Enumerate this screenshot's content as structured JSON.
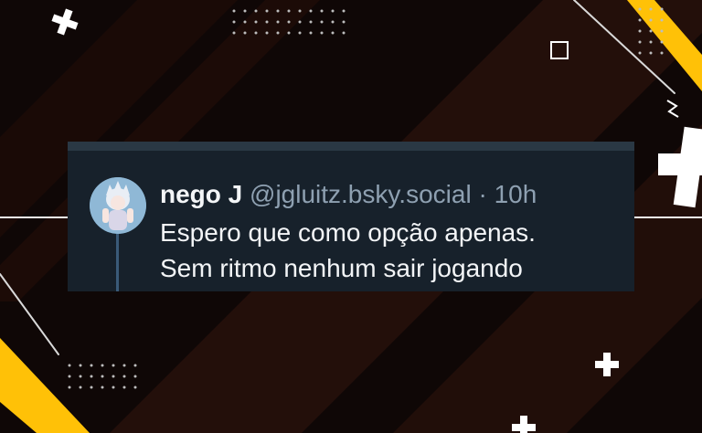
{
  "post": {
    "author_name": "nego J",
    "handle": "@jgluitz.bsky.social",
    "separator": "·",
    "time": "10h",
    "text_lines": [
      "Espero que como opção apenas.",
      "Sem ritmo nenhum sair jogando"
    ]
  },
  "colors": {
    "background": "#0f0706",
    "stripe": "#2a120c",
    "accent_yellow": "#ffc107",
    "card": "#17212b",
    "text_primary": "#f3f5f7",
    "text_secondary": "#8ea0b1",
    "thread_line": "#3a5a78"
  },
  "icons": {
    "avatar": "anime-character-avatar",
    "decorations": [
      "plus-icon",
      "square-outline-icon",
      "dot-grid",
      "diagonal-stripe"
    ]
  }
}
